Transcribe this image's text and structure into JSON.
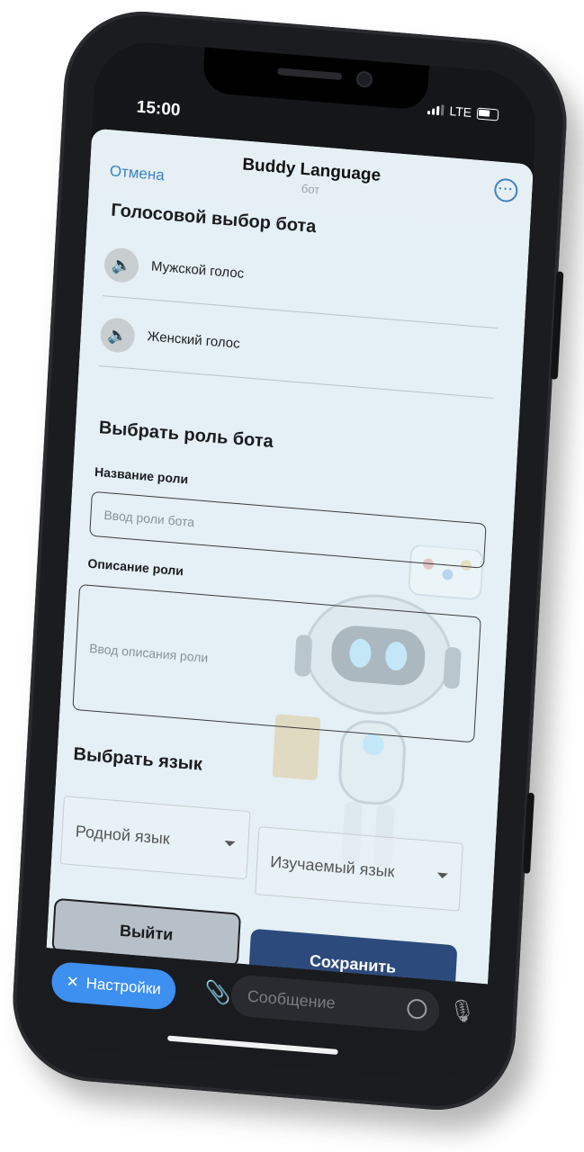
{
  "status_bar": {
    "time": "15:00",
    "network": "LTE"
  },
  "header": {
    "cancel_label": "Отмена",
    "title": "Buddy Language",
    "subtitle": "бот",
    "more_icon": "more-dots-icon"
  },
  "voice_section": {
    "title": "Голосовой выбор бота",
    "options": [
      {
        "label": "Мужской голос",
        "icon": "speaker-icon"
      },
      {
        "label": "Женский голос",
        "icon": "speaker-icon"
      }
    ]
  },
  "role_section": {
    "title": "Выбрать роль бота",
    "name_label": "Название роли",
    "name_placeholder": "Ввод роли бота",
    "desc_label": "Описание роли",
    "desc_placeholder": "Ввод описания роли"
  },
  "language_section": {
    "title": "Выбрать язык",
    "native_select": "Родной язык",
    "learn_select": "Изучаемый язык"
  },
  "actions": {
    "exit_label": "Выйти",
    "save_label": "Сохранить"
  },
  "bottom_bar": {
    "settings_label": "Настройки",
    "message_placeholder": "Сообщение"
  },
  "colors": {
    "accent": "#3b82c4",
    "save_button": "#2d4a7c",
    "sheet_bg": "#e4f0f5"
  }
}
